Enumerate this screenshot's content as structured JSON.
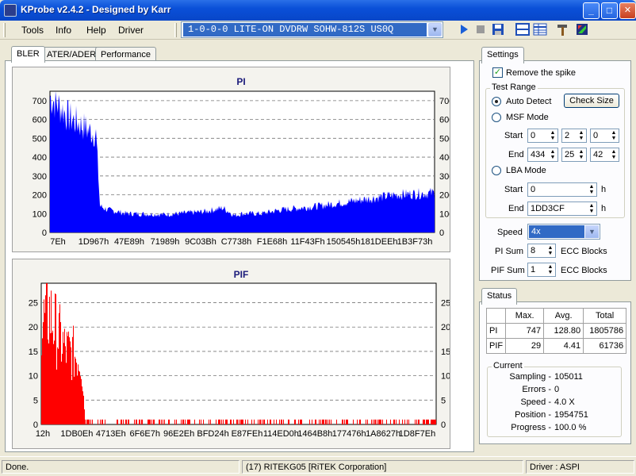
{
  "window": {
    "title": "KProbe v2.4.2 - Designed by Karr",
    "minimize": "_",
    "maximize": "□",
    "close": "✕"
  },
  "menu": [
    "Tools",
    "Info",
    "Help",
    "Driver"
  ],
  "drive": {
    "selected": "1-0-0-0 LITE-ON DVDRW SOHW-812S  US0Q"
  },
  "toolbar": [
    "play-icon",
    "stop-icon",
    "save-icon",
    "split-view-icon",
    "table-view-icon",
    "tools-icon",
    "exit-icon"
  ],
  "tabs": [
    "BLER",
    "ATER/ADER",
    "Performance"
  ],
  "charts": {
    "pi": {
      "title": "PI",
      "y_ticks": [
        "0",
        "100",
        "200",
        "300",
        "400",
        "500",
        "600",
        "700"
      ],
      "x_ticks": [
        "7Eh",
        "1D967h",
        "47E89h",
        "71989h",
        "9C03Bh",
        "C7738h",
        "F1E68h",
        "11F43Fh",
        "150545h",
        "181DEEh",
        "1B3F73h"
      ]
    },
    "pif": {
      "title": "PIF",
      "y_ticks": [
        "0",
        "5",
        "10",
        "15",
        "20",
        "25"
      ],
      "x_ticks": [
        "12h",
        "1DB0Eh",
        "4713Eh",
        "6F6E7h",
        "96E2Eh",
        "BFD24h",
        "E87FEh",
        "114ED0h",
        "1464B8h",
        "177476h",
        "1A8627h",
        "1D8F7Eh"
      ]
    }
  },
  "chart_data": [
    {
      "type": "area",
      "title": "PI",
      "ylim": [
        0,
        750
      ],
      "grid": true,
      "color": "#0000ff",
      "x": [
        0,
        0.02,
        0.05,
        0.09,
        0.1,
        0.12,
        0.13,
        0.15,
        0.2,
        0.3,
        0.4,
        0.45,
        0.48,
        0.5,
        0.55,
        0.6,
        0.7,
        0.8,
        0.9,
        1.0
      ],
      "values": [
        720,
        680,
        610,
        560,
        540,
        520,
        140,
        120,
        100,
        95,
        110,
        130,
        90,
        100,
        100,
        120,
        140,
        170,
        200,
        210
      ]
    },
    {
      "type": "bar",
      "title": "PIF",
      "ylim": [
        0,
        29
      ],
      "grid": true,
      "color": "#ff0000",
      "x": [
        0,
        0.02,
        0.04,
        0.06,
        0.08,
        0.1,
        0.11,
        0.12,
        0.2,
        0.4,
        0.6,
        0.8,
        1.0
      ],
      "values": [
        24,
        27,
        22,
        18,
        17,
        16,
        2,
        1,
        1,
        1,
        1,
        1,
        1
      ]
    }
  ],
  "settings": {
    "tab": "Settings",
    "remove_spike": {
      "label": "Remove the spike",
      "checked": true
    },
    "test_range_label": "Test Range",
    "auto_detect": "Auto Detect",
    "check_size": "Check Size",
    "msf_mode": "MSF Mode",
    "start_label": "Start",
    "end_label": "End",
    "msf_start": [
      "0",
      "2",
      "0"
    ],
    "msf_end": [
      "434",
      "25",
      "42"
    ],
    "lba_mode": "LBA Mode",
    "lba_start": "0",
    "lba_end": "1DD3CF",
    "unit": "h",
    "speed_label": "Speed",
    "speed_value": "4x",
    "pi_sum_label": "PI Sum",
    "pi_sum_value": "8",
    "pif_sum_label": "PIF Sum",
    "pif_sum_value": "1",
    "ecc_blocks": "ECC Blocks"
  },
  "status": {
    "tab": "Status",
    "headers": [
      "",
      "Max.",
      "Avg.",
      "Total"
    ],
    "rows": [
      {
        "label": "PI",
        "max": "747",
        "avg": "128.80",
        "total": "1805786"
      },
      {
        "label": "PIF",
        "max": "29",
        "avg": "4.41",
        "total": "61736"
      }
    ],
    "current_label": "Current",
    "current": [
      {
        "label": "Sampling -",
        "value": "105011"
      },
      {
        "label": "Errors -",
        "value": "0"
      },
      {
        "label": "Speed -",
        "value": "4.0  X"
      },
      {
        "label": "Position -",
        "value": "1954751"
      },
      {
        "label": "Progress -",
        "value": "100.0 %"
      }
    ]
  },
  "statusbar": {
    "left": "Done.",
    "center": "(17) RITEKG05 [RiTEK Corporation]",
    "right": "Driver : ASPI"
  }
}
